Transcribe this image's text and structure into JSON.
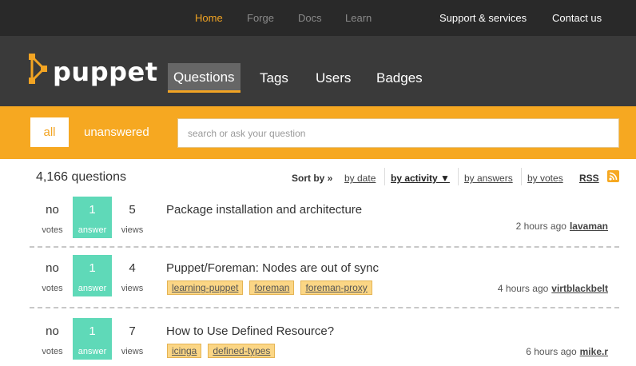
{
  "topnav": {
    "home": "Home",
    "forge": "Forge",
    "docs": "Docs",
    "learn": "Learn",
    "support": "Support & services",
    "contact": "Contact us"
  },
  "brand": {
    "logo_text": "puppet",
    "accent": "#f2a423"
  },
  "mainnav": {
    "questions": "Questions",
    "tags": "Tags",
    "users": "Users",
    "badges": "Badges"
  },
  "scope": {
    "all": "all",
    "unanswered": "unanswered"
  },
  "search": {
    "placeholder": "search or ask your question",
    "value": ""
  },
  "list": {
    "count": "4,166 questions",
    "sort_label": "Sort by »",
    "sort_date": "by date",
    "sort_activity": "by activity ▼",
    "sort_answers": "by answers",
    "sort_votes": "by votes",
    "rss": "RSS"
  },
  "questions": [
    {
      "votes": "no",
      "votes_label": "votes",
      "answers": "1",
      "answers_label": "answer",
      "views": "5",
      "views_label": "views",
      "title": "Package installation and architecture",
      "tags": [],
      "time": "2 hours ago",
      "user": "lavaman"
    },
    {
      "votes": "no",
      "votes_label": "votes",
      "answers": "1",
      "answers_label": "answer",
      "views": "4",
      "views_label": "views",
      "title": "Puppet/Foreman: Nodes are out of sync",
      "tags": [
        "learning-puppet",
        "foreman",
        "foreman-proxy"
      ],
      "time": "4 hours ago",
      "user": "virtblackbelt"
    },
    {
      "votes": "no",
      "votes_label": "votes",
      "answers": "1",
      "answers_label": "answer",
      "views": "7",
      "views_label": "views",
      "title": "How to Use Defined Resource?",
      "tags": [
        "icinga",
        "defined-types"
      ],
      "time": "6 hours ago",
      "user": "mike.r"
    }
  ]
}
